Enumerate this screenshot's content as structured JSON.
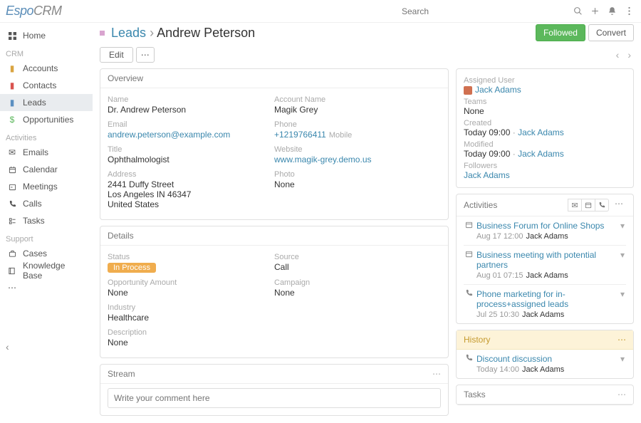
{
  "topbar": {
    "search_placeholder": "Search",
    "logo_a": "Espo",
    "logo_b": "CRM"
  },
  "sidebar": {
    "home": "Home",
    "section_crm": "CRM",
    "crm": [
      "Accounts",
      "Contacts",
      "Leads",
      "Opportunities"
    ],
    "section_activities": "Activities",
    "activities": [
      "Emails",
      "Calendar",
      "Meetings",
      "Calls",
      "Tasks"
    ],
    "section_support": "Support",
    "support": [
      "Cases",
      "Knowledge Base"
    ]
  },
  "head": {
    "module": "Leads",
    "sep": " › ",
    "name": "Andrew Peterson",
    "followed": "Followed",
    "convert": "Convert"
  },
  "toolbar": {
    "edit": "Edit"
  },
  "overview": {
    "title": "Overview",
    "name_label": "Name",
    "name": "Dr. Andrew Peterson",
    "account_label": "Account Name",
    "account": "Magik Grey",
    "email_label": "Email",
    "email": "andrew.peterson@example.com",
    "phone_label": "Phone",
    "phone": "+1219766411",
    "phone_type": "Mobile",
    "title_label": "Title",
    "title_val": "Ophthalmologist",
    "website_label": "Website",
    "website": "www.magik-grey.demo.us",
    "address_label": "Address",
    "addr1": "2441 Duffy Street",
    "addr2": "Los Angeles IN 46347",
    "addr3": "United States",
    "photo_label": "Photo",
    "photo": "None"
  },
  "details": {
    "title": "Details",
    "status_label": "Status",
    "status": "In Process",
    "source_label": "Source",
    "source": "Call",
    "oppamt_label": "Opportunity Amount",
    "oppamt": "None",
    "campaign_label": "Campaign",
    "campaign": "None",
    "industry_label": "Industry",
    "industry": "Healthcare",
    "desc_label": "Description",
    "desc": "None"
  },
  "stream": {
    "title": "Stream",
    "placeholder": "Write your comment here"
  },
  "side": {
    "assigned_label": "Assigned User",
    "assigned": "Jack Adams",
    "teams_label": "Teams",
    "teams": "None",
    "created_label": "Created",
    "created_time": "Today 09:00",
    "created_by": "Jack Adams",
    "modified_label": "Modified",
    "modified_time": "Today 09:00",
    "modified_by": "Jack Adams",
    "followers_label": "Followers",
    "followers": "Jack Adams"
  },
  "activities": {
    "title": "Activities",
    "items": [
      {
        "icon": "cal",
        "title": "Business Forum for Online Shops",
        "time": "Aug 17 12:00",
        "by": "Jack Adams"
      },
      {
        "icon": "cal",
        "title": "Business meeting with potential partners",
        "time": "Aug 01 07:15",
        "by": "Jack Adams"
      },
      {
        "icon": "phone",
        "title": "Phone marketing for in-process+assigned leads",
        "time": "Jul 25 10:30",
        "by": "Jack Adams"
      }
    ]
  },
  "history": {
    "title": "History",
    "items": [
      {
        "icon": "phone",
        "title": "Discount discussion",
        "time": "Today 14:00",
        "by": "Jack Adams"
      }
    ]
  },
  "tasks": {
    "title": "Tasks"
  }
}
